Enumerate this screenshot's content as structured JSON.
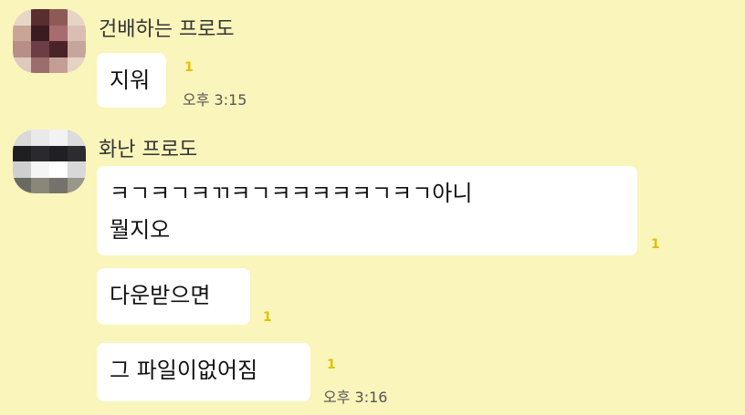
{
  "messages": [
    {
      "sender": "건배하는 프로도",
      "bubbles": [
        {
          "lines": [
            "지워"
          ],
          "unread": "1",
          "time": "오후 3:15"
        }
      ]
    },
    {
      "sender": "화난 프로도",
      "bubbles": [
        {
          "lines": [
            "ㅋㄱㅋㄱㅋㄲㅋㄱㅋㅋㅋㅋㅋㄱㅋㄱ아니",
            "뭘지오"
          ],
          "unread": "1",
          "time": ""
        },
        {
          "lines": [
            "다운받으면"
          ],
          "unread": "1",
          "time": ""
        },
        {
          "lines": [
            "그 파일이없어짐"
          ],
          "unread": "1",
          "time": "오후 3:16"
        }
      ]
    }
  ],
  "colors": {
    "background": "#f9f5bb",
    "bubble": "#ffffff",
    "unread": "#e0c100"
  }
}
